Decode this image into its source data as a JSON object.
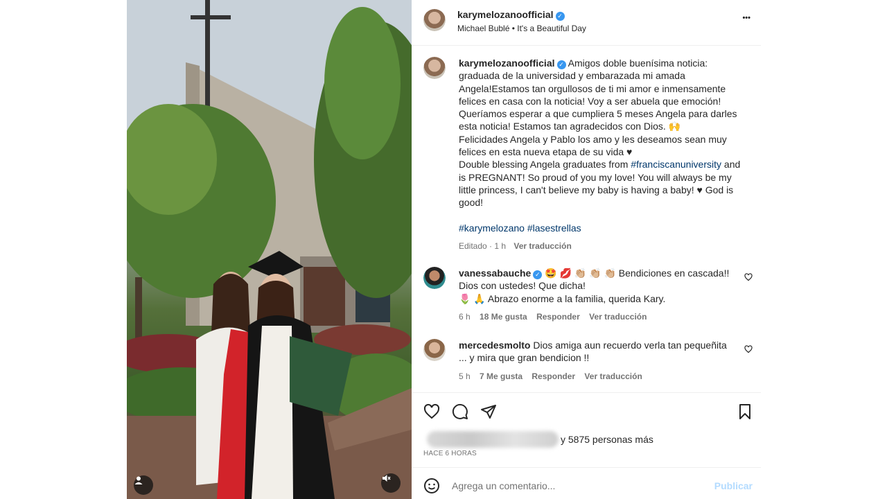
{
  "photo": {
    "icons": [
      "user-tag-icon",
      "mute-icon"
    ]
  },
  "header": {
    "username": "karymelozanoofficial",
    "verified": true,
    "audio": "Michael Bublé • It's a Beautiful Day",
    "more": "•••"
  },
  "caption": {
    "username": "karymelozanoofficial",
    "text_es": "Amigos doble buenísima noticia: graduada de la universidad y embarazada mi amada Angela!Estamos tan orgullosos de ti mi amor e inmensamente felices en casa con la noticia! Voy a ser abuela que emoción! Queríamos esperar a que cumpliera 5 meses Angela para darles esta noticia! Estamos tan agradecidos con Dios. 🙌",
    "text_es2": "Felicidades Angela y Pablo los amo y les deseamos sean muy felices en esta nueva etapa de su vida ♥",
    "text_en_pre": "Double blessing Angela graduates from ",
    "text_en_tag": "#franciscanuniversity",
    "text_en_post": " and is PREGNANT! So proud of you my love! You will always be my little princess, I can't believe my baby is having a baby! ♥ God is good!",
    "hashtag1": "#karymelozano",
    "hashtag2": "#lasestrellas",
    "edited": "Editado",
    "time": "1 h",
    "translate": "Ver traducción"
  },
  "comments": [
    {
      "username": "vanessabauche",
      "verified": true,
      "line1": "🤩 💋 👏🏼 👏🏼 👏🏼 Bendiciones en cascada!!",
      "line2": "Dios con ustedes! Que dicha!",
      "line3": "🌷 🙏 Abrazo enorme a la familia, querida Kary.",
      "time": "6 h",
      "likes": "18 Me gusta",
      "reply": "Responder",
      "translate": "Ver traducción"
    },
    {
      "username": "mercedesmolto",
      "verified": false,
      "line1": "Dios amiga aun recuerdo verla tan pequeñita",
      "line2": "... y mira que gran bendicion !!",
      "time": "5 h",
      "likes": "7 Me gusta",
      "reply": "Responder",
      "translate": "Ver traducción"
    }
  ],
  "likes": {
    "text": "y 5875 personas más"
  },
  "posted": "HACE 6 HORAS",
  "composer": {
    "placeholder": "Agrega un comentario...",
    "publish": "Publicar"
  },
  "colors": {
    "link": "#00376b",
    "verified": "#3897f0",
    "publish": "#b3dbff"
  }
}
